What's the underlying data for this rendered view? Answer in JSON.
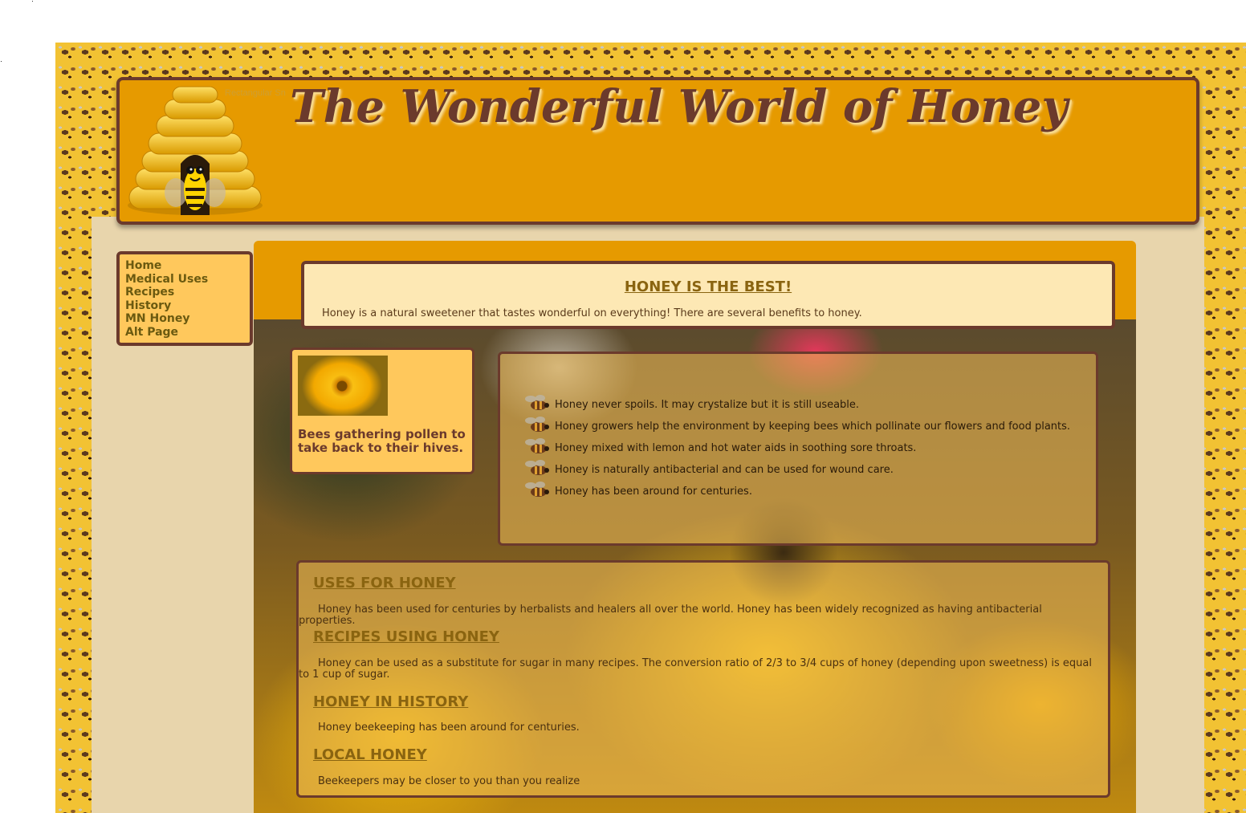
{
  "header": {
    "title": "The Wonderful World of Honey",
    "ghost_label": "Rectangular Sn"
  },
  "nav": {
    "items": [
      "Home",
      "Medical Uses",
      "Recipes",
      "History",
      "MN Honey",
      "Alt Page"
    ]
  },
  "intro": {
    "heading": "HONEY IS THE BEST!",
    "text": "Honey is a natural sweetener that tastes wonderful on everything! There are several benefits to honey."
  },
  "caption": {
    "text": "Bees gathering pollen to take back to their hives."
  },
  "facts": [
    "Honey never spoils. It may crystalize but it is still useable.",
    "Honey growers help the environment by keeping bees which pollinate our flowers and food plants.",
    "Honey mixed with lemon and hot water aids in soothing sore throats.",
    "Honey is naturally antibacterial and can be used for wound care.",
    "Honey has been around for centuries."
  ],
  "sections": [
    {
      "heading": "USES FOR HONEY",
      "text": "Honey has been used for centuries by herbalists and healers all over the world. Honey has been widely recognized as having antibacterial properties."
    },
    {
      "heading": "RECIPES USING HONEY",
      "text": "Honey can be used as a substitute for sugar in many recipes. The conversion ratio of 2/3 to 3/4 cups of honey (depending upon sweetness) is equal to 1 cup of sugar."
    },
    {
      "heading": "HONEY IN HISTORY",
      "text": "Honey beekeeping has been around for centuries."
    },
    {
      "heading": "LOCAL HONEY",
      "text": "Beekeepers may be closer to you than you realize"
    }
  ],
  "colors": {
    "header_bg": "#e69a00",
    "border": "#6b3a2c",
    "nav_bg": "#ffc85c",
    "heading": "#8a6410",
    "page_bg": "#e8d5ac"
  },
  "icons": [
    "beehive-logo",
    "bee-bullet-icon",
    "flower-photo",
    "bee-on-flower-background"
  ]
}
